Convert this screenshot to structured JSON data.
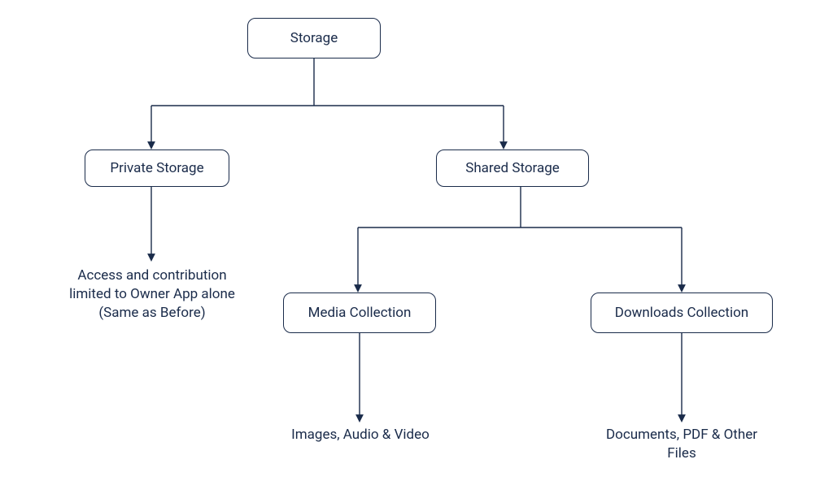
{
  "chart_data": {
    "type": "tree",
    "title": "",
    "root": {
      "id": "storage",
      "label": "Storage",
      "children": [
        {
          "id": "private-storage",
          "label": "Private Storage",
          "note": "Access and contribution limited to Owner App alone (Same as Before)"
        },
        {
          "id": "shared-storage",
          "label": "Shared Storage",
          "children": [
            {
              "id": "media-collection",
              "label": "Media Collection",
              "note": "Images, Audio & Video"
            },
            {
              "id": "downloads-collection",
              "label": "Downloads Collection",
              "note": "Documents, PDF & Other Files"
            }
          ]
        }
      ]
    }
  },
  "nodes": {
    "storage": "Storage",
    "private_storage": "Private Storage",
    "shared_storage": "Shared Storage",
    "media_collection": "Media Collection",
    "downloads_collection": "Downloads Collection"
  },
  "labels": {
    "private_note": "Access and contribution limited to Owner App alone (Same as Before)",
    "media_note": "Images, Audio & Video",
    "downloads_note": "Documents, PDF & Other Files"
  },
  "colors": {
    "stroke": "#1a2b4a",
    "text": "#1a2b4a",
    "bg": "#ffffff"
  }
}
